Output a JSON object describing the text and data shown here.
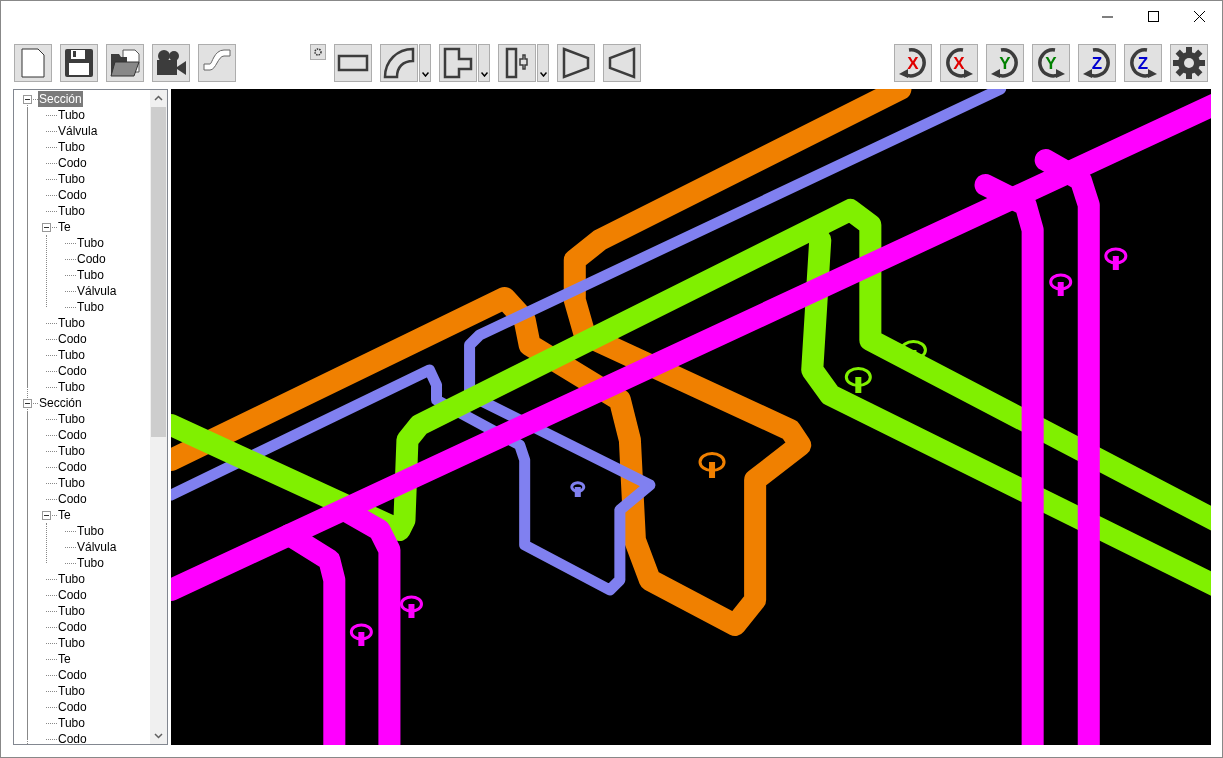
{
  "toolbar_left": [
    {
      "kind": "new"
    },
    {
      "kind": "save"
    },
    {
      "kind": "open"
    },
    {
      "kind": "camera"
    },
    {
      "kind": "pipe"
    }
  ],
  "toolbar_mid": [
    {
      "kind": "rect",
      "dropdown": false
    },
    {
      "kind": "elbow",
      "dropdown": true
    },
    {
      "kind": "tee",
      "dropdown": true
    },
    {
      "kind": "valve",
      "dropdown": true
    },
    {
      "kind": "reducer",
      "dropdown": false
    },
    {
      "kind": "expander",
      "dropdown": false
    }
  ],
  "toolbar_right": [
    {
      "kind": "rotate",
      "axis": "X",
      "color": "#e00000",
      "ccw": false
    },
    {
      "kind": "rotate",
      "axis": "X",
      "color": "#e00000",
      "ccw": true
    },
    {
      "kind": "rotate",
      "axis": "Y",
      "color": "#008000",
      "ccw": false
    },
    {
      "kind": "rotate",
      "axis": "Y",
      "color": "#008000",
      "ccw": true
    },
    {
      "kind": "rotate",
      "axis": "Z",
      "color": "#0000d0",
      "ccw": false
    },
    {
      "kind": "rotate",
      "axis": "Z",
      "color": "#0000d0",
      "ccw": true
    },
    {
      "kind": "settings"
    }
  ],
  "tree": [
    {
      "label": "Sección",
      "selected": true,
      "expanded": true,
      "children": [
        {
          "label": "Tubo",
          "selected": false
        },
        {
          "label": "Válvula",
          "selected": false
        },
        {
          "label": "Tubo",
          "selected": false
        },
        {
          "label": "Codo",
          "selected": false
        },
        {
          "label": "Tubo",
          "selected": false
        },
        {
          "label": "Codo",
          "selected": false
        },
        {
          "label": "Tubo",
          "selected": false
        },
        {
          "label": "Te",
          "selected": false,
          "expanded": true,
          "children": [
            {
              "label": "Tubo",
              "selected": false
            },
            {
              "label": "Codo",
              "selected": false
            },
            {
              "label": "Tubo",
              "selected": false
            },
            {
              "label": "Válvula",
              "selected": false
            },
            {
              "label": "Tubo",
              "selected": false
            }
          ]
        },
        {
          "label": "Tubo",
          "selected": false
        },
        {
          "label": "Codo",
          "selected": false
        },
        {
          "label": "Tubo",
          "selected": false
        },
        {
          "label": "Codo",
          "selected": false
        },
        {
          "label": "Tubo",
          "selected": false
        }
      ]
    },
    {
      "label": "Sección",
      "selected": false,
      "expanded": true,
      "children": [
        {
          "label": "Tubo",
          "selected": false
        },
        {
          "label": "Codo",
          "selected": false
        },
        {
          "label": "Tubo",
          "selected": false
        },
        {
          "label": "Codo",
          "selected": false
        },
        {
          "label": "Tubo",
          "selected": false
        },
        {
          "label": "Codo",
          "selected": false
        },
        {
          "label": "Te",
          "selected": false,
          "expanded": true,
          "children": [
            {
              "label": "Tubo",
              "selected": false
            },
            {
              "label": "Válvula",
              "selected": false
            },
            {
              "label": "Tubo",
              "selected": false
            }
          ]
        },
        {
          "label": "Tubo",
          "selected": false
        },
        {
          "label": "Codo",
          "selected": false
        },
        {
          "label": "Tubo",
          "selected": false
        },
        {
          "label": "Codo",
          "selected": false
        },
        {
          "label": "Tubo",
          "selected": false
        },
        {
          "label": "Te",
          "selected": false
        },
        {
          "label": "Codo",
          "selected": false
        },
        {
          "label": "Tubo",
          "selected": false
        },
        {
          "label": "Codo",
          "selected": false
        },
        {
          "label": "Tubo",
          "selected": false
        },
        {
          "label": "Codo",
          "selected": false
        }
      ]
    }
  ]
}
